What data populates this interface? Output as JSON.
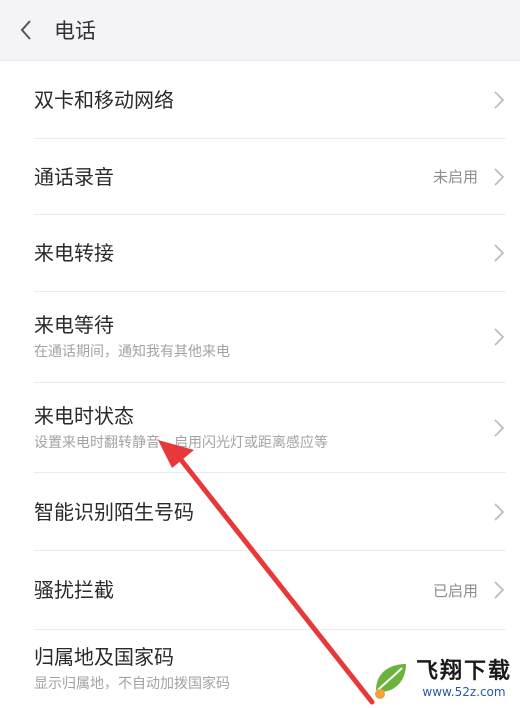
{
  "header": {
    "title": "电话"
  },
  "rows": [
    {
      "label": "双卡和移动网络",
      "sub": "",
      "status": ""
    },
    {
      "label": "通话录音",
      "sub": "",
      "status": "未启用"
    },
    {
      "label": "来电转接",
      "sub": "",
      "status": ""
    },
    {
      "label": "来电等待",
      "sub": "在通话期间，通知我有其他来电",
      "status": ""
    },
    {
      "label": "来电时状态",
      "sub": "设置来电时翻转静音、启用闪光灯或距离感应等",
      "status": ""
    },
    {
      "label": "智能识别陌生号码",
      "sub": "",
      "status": ""
    },
    {
      "label": "骚扰拦截",
      "sub": "",
      "status": "已启用"
    },
    {
      "label": "归属地及国家码",
      "sub": "显示归属地，不自动加拨国家码",
      "status": ""
    }
  ],
  "watermark": {
    "title": "飞翔下载",
    "url": "www.52z.com"
  },
  "colors": {
    "annotation_arrow": "#e8393a",
    "header_bg": "#f4f3f6",
    "watermark_logo_green": "#6cb33e"
  }
}
